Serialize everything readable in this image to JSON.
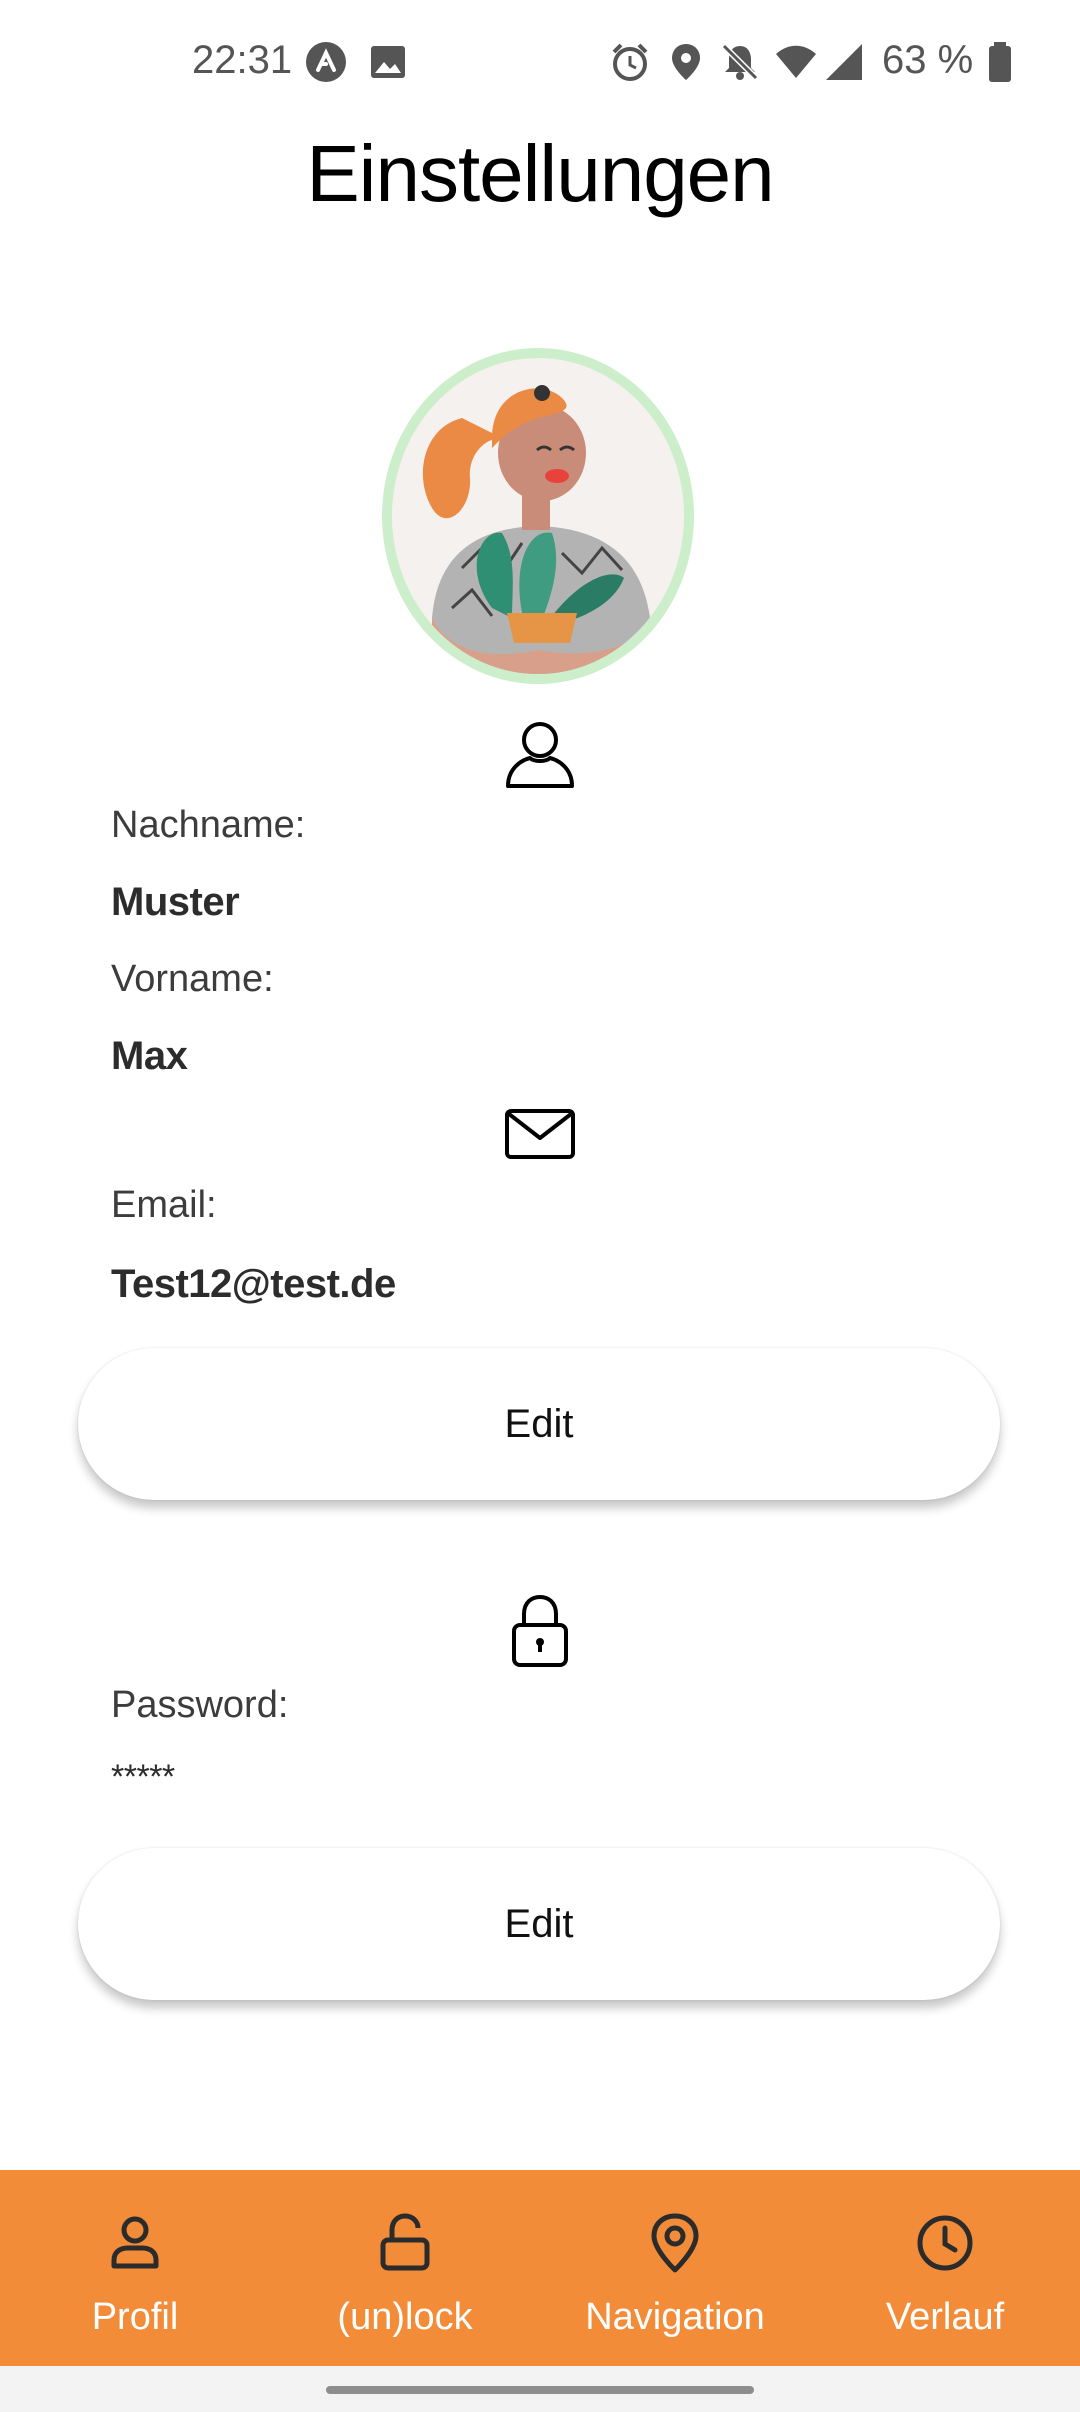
{
  "status_bar": {
    "time": "22:31",
    "battery_percent": "63 %",
    "icons": [
      "app-icon",
      "image-icon",
      "alarm-icon",
      "location-icon",
      "bell-off-icon",
      "wifi-icon",
      "signal-icon",
      "battery-icon"
    ]
  },
  "header": {
    "title": "Einstellungen"
  },
  "profile": {
    "avatar": "avatar-illustration",
    "lastname_label": "Nachname:",
    "lastname_value": "Muster",
    "firstname_label": "Vorname:",
    "firstname_value": "Max",
    "email_label": "Email:",
    "email_value": "Test12@test.de",
    "edit_profile_label": "Edit",
    "password_label": "Password:",
    "password_value": "*****",
    "edit_password_label": "Edit"
  },
  "bottom_nav": {
    "items": [
      {
        "label": "Profil",
        "icon": "person-icon"
      },
      {
        "label": "(un)lock",
        "icon": "unlock-icon"
      },
      {
        "label": "Navigation",
        "icon": "map-pin-icon"
      },
      {
        "label": "Verlauf",
        "icon": "clock-icon"
      }
    ]
  },
  "colors": {
    "accent": "#f28c38",
    "avatar_ring": "#cdeecb"
  }
}
